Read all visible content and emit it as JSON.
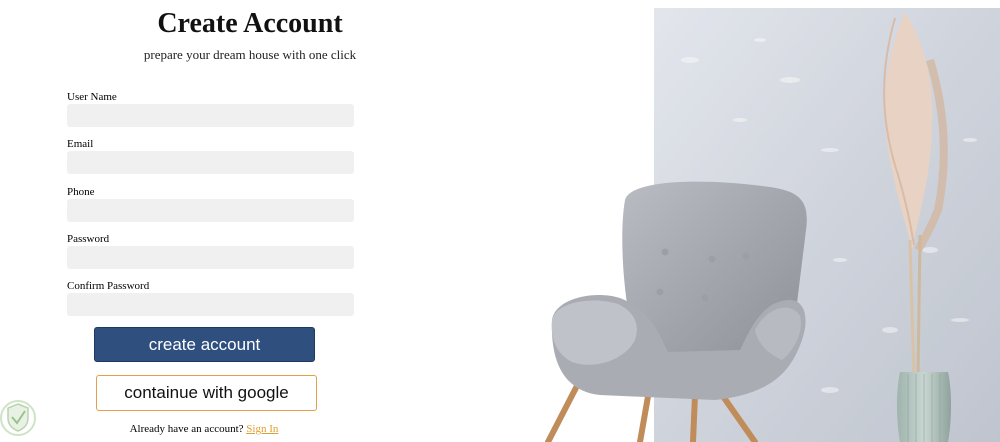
{
  "header": {
    "title": "Create Account",
    "subtitle": "prepare your dream house with one click"
  },
  "form": {
    "fields": [
      {
        "label": "User Name",
        "value": "",
        "placeholder": ""
      },
      {
        "label": "Email",
        "value": "",
        "placeholder": ""
      },
      {
        "label": "Phone",
        "value": "",
        "placeholder": ""
      },
      {
        "label": "Password",
        "value": "",
        "placeholder": ""
      },
      {
        "label": "Confirm Password",
        "value": "",
        "placeholder": ""
      }
    ],
    "submit_label": "create account",
    "google_label": "containue with google"
  },
  "footer": {
    "prompt": "Already have an account?",
    "signin_label": "Sign In"
  },
  "colors": {
    "primary_button": "#2f4f7f",
    "google_border": "#e2a04a",
    "link": "#e0a030",
    "input_bg": "#f0f0f0"
  },
  "icons": {
    "corner_logo": "shield-check-logo"
  }
}
